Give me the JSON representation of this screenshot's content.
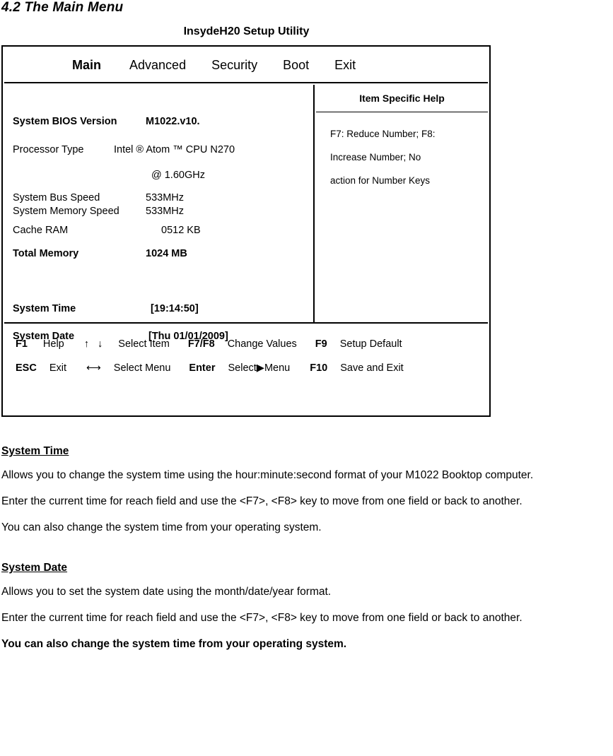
{
  "section_heading": "4.2 The Main Menu",
  "bios": {
    "utility_title": "InsydeH20 Setup Utility",
    "menu_tabs": [
      {
        "label": "Main",
        "selected": true
      },
      {
        "label": "Advanced",
        "selected": false
      },
      {
        "label": "Security",
        "selected": false
      },
      {
        "label": "Boot",
        "selected": false
      },
      {
        "label": "Exit",
        "selected": false
      }
    ],
    "info_rows": {
      "bios_version_label": "System BIOS Version",
      "bios_version_value": "M1022.v10.",
      "processor_label": "Processor Type",
      "processor_value": "Intel ® Atom ™ CPU N270",
      "processor_value_line2": "@ 1.60GHz",
      "bus_speed_label": "System Bus Speed",
      "bus_speed_value": "533MHz",
      "memory_speed_label": "System Memory Speed",
      "memory_speed_value": "533MHz",
      "cache_ram_label": "Cache RAM",
      "cache_ram_value": "0512 KB",
      "total_memory_label": "Total Memory",
      "total_memory_value": "1024 MB",
      "system_time_label": "System Time",
      "system_time_value": "[19:14:50]",
      "system_date_label": "System Date",
      "system_date_value": "[Thu 01/01/2009]"
    },
    "help_panel": {
      "header": "Item Specific Help",
      "lines": [
        "F7: Reduce Number; F8:",
        "Increase Number; No",
        "action for Number Keys"
      ]
    },
    "footer": {
      "row1": {
        "k1": "F1",
        "t1": "Help",
        "k2": "↑ ↓",
        "t2": "Select Item",
        "k3": "F7/F8",
        "t3": "Change Values",
        "k4": "F9",
        "t4": "Setup Default"
      },
      "row2": {
        "k1": "ESC",
        "t1": "Exit",
        "k2": "⟷",
        "t2": "Select Menu",
        "k3": "Enter",
        "t3": "Select",
        "glyph3": "▶",
        "t3b": "Menu",
        "k4": "F10",
        "t4": "Save and Exit"
      }
    }
  },
  "prose": {
    "system_time": {
      "heading": "System Time ",
      "p1": "Allows you to change the system time using the hour:minute:second format of your M1022 Booktop computer.",
      "p2": "Enter the current time for reach field and use the <F7>, <F8> key to move from one field or back to another.",
      "p3": "You can also change the system time from your operating system."
    },
    "system_date": {
      "heading": "System Date",
      "p1": "Allows you to set the system date using the month/date/year format.",
      "p2": "Enter the current time for reach field and use the <F7>, <F8> key to move from one field or back to another.",
      "p3": "You can also change the system time from your operating system."
    }
  }
}
